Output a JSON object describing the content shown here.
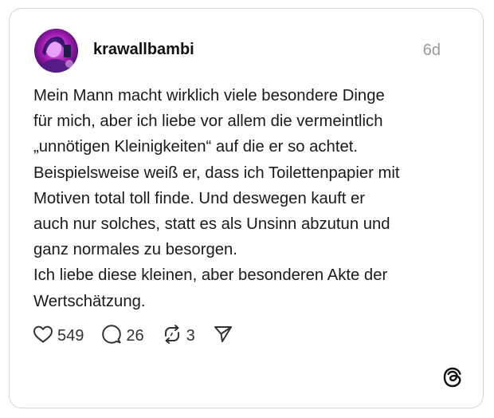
{
  "post": {
    "username": "krawallbambi",
    "timestamp": "6d",
    "text_lines": [
      "Mein Mann macht wirklich viele besondere Dinge",
      "für mich, aber ich liebe vor allem die vermeintlich",
      "„unnötigen Kleinigkeiten“ auf die er so achtet.",
      "Beispielsweise weiß er, dass ich Toilettenpapier mit",
      "Motiven total toll finde. Und deswegen kauft er",
      "auch nur solches, statt es als Unsinn abzutun und",
      "ganz normales zu besorgen.",
      "Ich liebe diese kleinen, aber besonderen Akte der",
      "Wertschätzung."
    ]
  },
  "actions": {
    "likes": "549",
    "replies": "26",
    "reposts": "3"
  },
  "icons": {
    "like": "heart-icon",
    "reply": "speech-bubble-icon",
    "repost": "repost-arrows-icon",
    "share": "paper-plane-icon",
    "brand": "threads-logo-icon"
  },
  "colors": {
    "text": "#111111",
    "muted": "#999999",
    "border": "#d6d6d6",
    "avatar_accent": "#c026d3"
  }
}
